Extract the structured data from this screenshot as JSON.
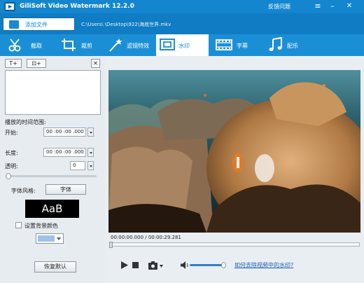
{
  "app": {
    "title": "GiliSoft Video Watermark 12.2.0",
    "feedback": "反馈问题"
  },
  "file_bar": {
    "add_file": "添加文件",
    "path": "C:\\Users\\         \\Desktop\\922\\海底世界.mkv"
  },
  "tabs": [
    {
      "label": "截取",
      "icon": "scissors-icon"
    },
    {
      "label": "裁剪",
      "icon": "crop-icon"
    },
    {
      "label": "滤镜特效",
      "icon": "magic-wand-icon"
    },
    {
      "label": "水印",
      "icon": "watermark-icon",
      "active": true
    },
    {
      "label": "字幕",
      "icon": "film-icon"
    },
    {
      "label": "配乐",
      "icon": "music-note-icon"
    }
  ],
  "left": {
    "add_text_btn": "T+",
    "add_image_btn": "⊡+",
    "time_range_label": "播放的时间范围:",
    "start_label": "开始:",
    "start_value": "00 :00 :00 .000",
    "length_label": "长度:",
    "length_value": "00 :00 :00 .000",
    "opacity_label": "透明:",
    "opacity_value": "0",
    "opacity_level": 0,
    "font_style_label": "字体风格:",
    "font_button": "字体",
    "font_preview": "AaB",
    "bg_color_label": "设置背景颜色",
    "bg_color": "#9cc2ee",
    "reset_button": "恢复默认"
  },
  "player": {
    "time": "00:00:00.000 / 00:00:29.281",
    "progress": 0,
    "volume": 0.9,
    "help_link": "如何去除视频中的水印?"
  }
}
